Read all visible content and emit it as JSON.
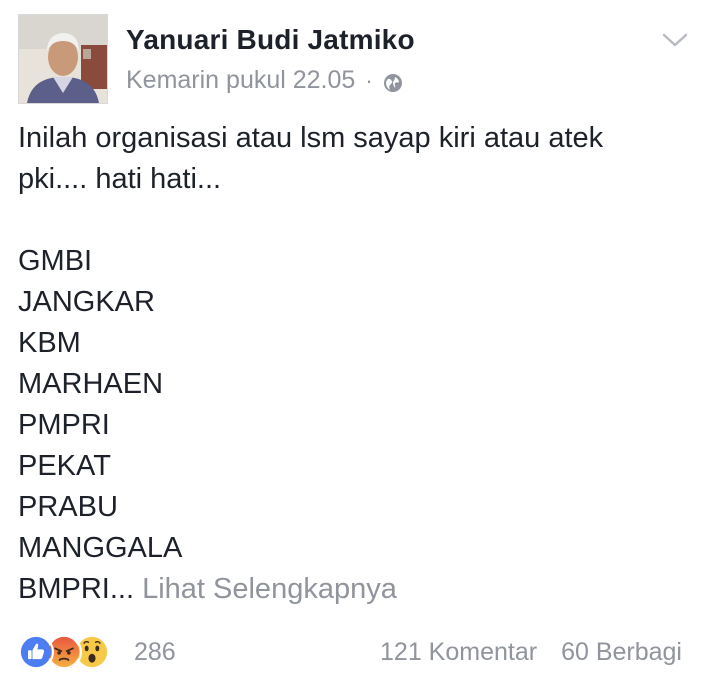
{
  "post": {
    "author": "Yanuari Budi Jatmiko",
    "timestamp": "Kemarin pukul 22.05",
    "separator": "·",
    "privacy_icon": "globe-icon",
    "menu_icon": "chevron-down-icon",
    "text_line1": "Inilah organisasi atau lsm sayap kiri atau atek",
    "text_line2": "pki.... hati hati...",
    "list": [
      "GMBI",
      "JANGKAR",
      "KBM",
      "MARHAEN",
      "PMPRI",
      "PEKAT",
      "PRABU",
      "MANGGALA"
    ],
    "last_item": "BMPRI...",
    "see_more": "Lihat Selengkapnya"
  },
  "footer": {
    "reactions": [
      "like-icon",
      "angry-icon",
      "wow-icon"
    ],
    "reaction_count": "286",
    "comments": "121 Komentar",
    "shares": "60 Berbagi"
  },
  "colors": {
    "text": "#1d2129",
    "muted": "#90949c",
    "like_blue": "#4c7ef2",
    "angry_red": "#e9573f",
    "wow_yellow": "#f7c948"
  }
}
